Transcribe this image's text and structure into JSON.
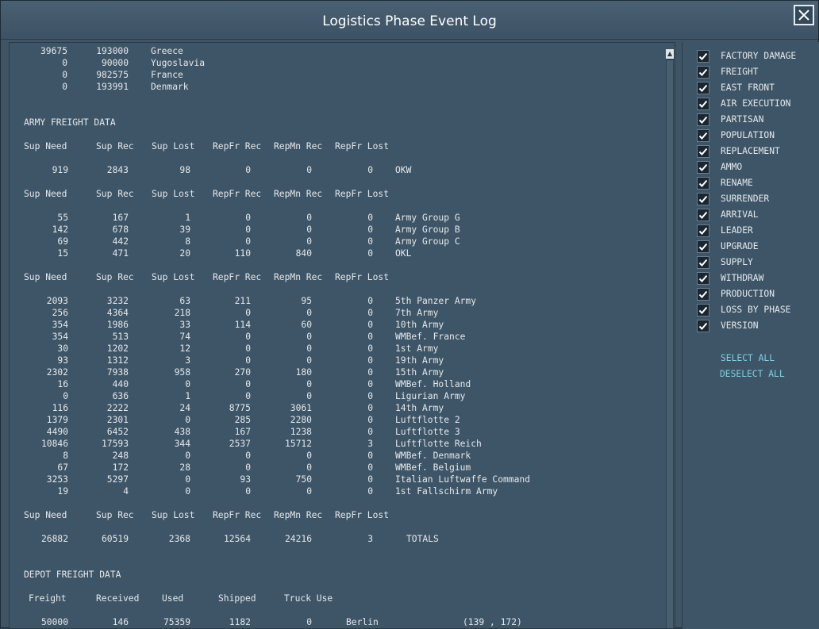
{
  "window": {
    "title": "Logistics Phase Event Log"
  },
  "filters": {
    "items": [
      {
        "label": "FACTORY DAMAGE",
        "checked": true
      },
      {
        "label": "FREIGHT",
        "checked": true
      },
      {
        "label": "EAST FRONT",
        "checked": true
      },
      {
        "label": "AIR EXECUTION",
        "checked": true
      },
      {
        "label": "PARTISAN",
        "checked": true
      },
      {
        "label": "POPULATION",
        "checked": true
      },
      {
        "label": "REPLACEMENT",
        "checked": true
      },
      {
        "label": "AMMO",
        "checked": true
      },
      {
        "label": "RENAME",
        "checked": true
      },
      {
        "label": "SURRENDER",
        "checked": true
      },
      {
        "label": "ARRIVAL",
        "checked": true
      },
      {
        "label": "LEADER",
        "checked": true
      },
      {
        "label": "UPGRADE",
        "checked": true
      },
      {
        "label": "SUPPLY",
        "checked": true
      },
      {
        "label": "WITHDRAW",
        "checked": true
      },
      {
        "label": "PRODUCTION",
        "checked": true
      },
      {
        "label": "LOSS BY PHASE",
        "checked": true
      },
      {
        "label": "VERSION",
        "checked": true
      }
    ],
    "select_all": "SELECT ALL",
    "deselect_all": "DESELECT ALL"
  },
  "log": {
    "nation_rows": [
      {
        "a": "39675",
        "b": "193000",
        "name": "Greece"
      },
      {
        "a": "0",
        "b": "90000",
        "name": "Yugoslavia"
      },
      {
        "a": "0",
        "b": "982575",
        "name": "France"
      },
      {
        "a": "0",
        "b": "193991",
        "name": "Denmark"
      }
    ],
    "army_section_title": "ARMY FREIGHT DATA",
    "army_headers": [
      "Sup Need",
      "Sup Rec",
      "Sup Lost",
      "RepFr Rec",
      "RepMn Rec",
      "RepFr Lost"
    ],
    "army_groups": [
      [
        [
          "919",
          "2843",
          "98",
          "0",
          "0",
          "0",
          "OKW"
        ]
      ],
      [
        [
          "55",
          "167",
          "1",
          "0",
          "0",
          "0",
          "Army Group G"
        ],
        [
          "142",
          "678",
          "39",
          "0",
          "0",
          "0",
          "Army Group B"
        ],
        [
          "69",
          "442",
          "8",
          "0",
          "0",
          "0",
          "Army Group C"
        ],
        [
          "15",
          "471",
          "20",
          "110",
          "840",
          "0",
          "OKL"
        ]
      ],
      [
        [
          "2093",
          "3232",
          "63",
          "211",
          "95",
          "0",
          "5th Panzer Army"
        ],
        [
          "256",
          "4364",
          "218",
          "0",
          "0",
          "0",
          "7th Army"
        ],
        [
          "354",
          "1986",
          "33",
          "114",
          "60",
          "0",
          "10th Army"
        ],
        [
          "354",
          "513",
          "74",
          "0",
          "0",
          "0",
          "WMBef. France"
        ],
        [
          "30",
          "1202",
          "12",
          "0",
          "0",
          "0",
          "1st Army"
        ],
        [
          "93",
          "1312",
          "3",
          "0",
          "0",
          "0",
          "19th Army"
        ],
        [
          "2302",
          "7938",
          "958",
          "270",
          "180",
          "0",
          "15th Army"
        ],
        [
          "16",
          "440",
          "0",
          "0",
          "0",
          "0",
          "WMBef. Holland"
        ],
        [
          "0",
          "636",
          "1",
          "0",
          "0",
          "0",
          "Ligurian Army"
        ],
        [
          "116",
          "2222",
          "24",
          "8775",
          "3061",
          "0",
          "14th Army"
        ],
        [
          "1379",
          "2301",
          "0",
          "285",
          "2280",
          "0",
          "Luftflotte 2"
        ],
        [
          "4490",
          "6452",
          "438",
          "167",
          "1238",
          "0",
          "Luftflotte 3"
        ],
        [
          "10846",
          "17593",
          "344",
          "2537",
          "15712",
          "3",
          "Luftflotte Reich"
        ],
        [
          "8",
          "248",
          "0",
          "0",
          "0",
          "0",
          "WMBef. Denmark"
        ],
        [
          "67",
          "172",
          "28",
          "0",
          "0",
          "0",
          "WMBef. Belgium"
        ],
        [
          "3253",
          "5297",
          "0",
          "93",
          "750",
          "0",
          "Italian Luftwaffe Command"
        ],
        [
          "19",
          "4",
          "0",
          "0",
          "0",
          "0",
          "1st Fallschirm Army"
        ]
      ]
    ],
    "totals": [
      "26882",
      "60519",
      "2368",
      "12564",
      "24216",
      "3",
      "TOTALS"
    ],
    "depot_section_title": "DEPOT FREIGHT DATA",
    "depot_headers": [
      "Freight",
      "Received",
      "Used",
      "Shipped",
      "Truck Use"
    ],
    "depot_rows": [
      [
        "50000",
        "146",
        "75359",
        "1182",
        "0",
        "Berlin",
        "(139 , 172)"
      ]
    ]
  }
}
